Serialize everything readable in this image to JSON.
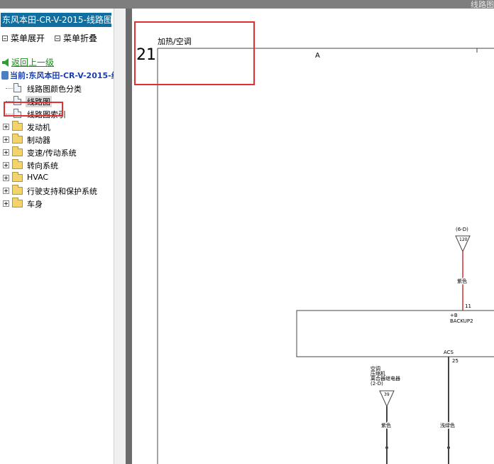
{
  "window": {
    "title_fragment": "线路图"
  },
  "sidebar": {
    "title": "东风本田-CR-V-2015-线路图",
    "expand_label": "菜单展开",
    "collapse_label": "菜单折叠",
    "back_label": "返回上一级",
    "current_label": "当前:东风本田-CR-V-2015-线",
    "docs": [
      {
        "label": "线路图颜色分类"
      },
      {
        "label": "线路图"
      },
      {
        "label": "线路图索引"
      }
    ],
    "folders": [
      {
        "label": "发动机"
      },
      {
        "label": "制动器"
      },
      {
        "label": "变速/传动系统"
      },
      {
        "label": "转向系统"
      },
      {
        "label": "HVAC"
      },
      {
        "label": "行驶支持和保护系统"
      },
      {
        "label": "车身"
      }
    ],
    "selected_index": 1,
    "colors": {
      "title_bg": "#0e6fa0",
      "link": "#1a8a1a",
      "current": "#1a3fa8",
      "highlight": "#e03030"
    }
  },
  "diagram": {
    "page_number": "21",
    "section_title": "加热/空调",
    "zone_label": "A",
    "conn_top": {
      "ref": "(6-D)",
      "pin": "120"
    },
    "wire_top_color_label": "紫色",
    "terminal_11": "11",
    "terminal_b": "+B",
    "backup_label": "BACKUP2",
    "acs_label": "ACS",
    "terminal_25": "25",
    "conn_left": {
      "line1": "空调",
      "line2": "压缩机",
      "line3": "离合器继电器",
      "line4": "(2-D)",
      "pin": "39"
    },
    "wire_left_color_label": "紫色",
    "wire_right_color_label": "浅绿色",
    "colors": {
      "red_wire": "#d03030"
    }
  }
}
